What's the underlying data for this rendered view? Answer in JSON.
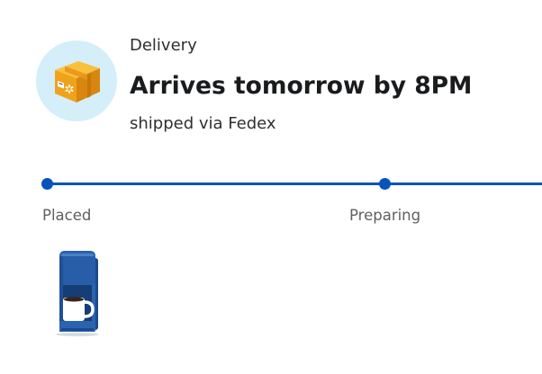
{
  "delivery": {
    "label": "Delivery",
    "title": "Arrives tomorrow by 8PM",
    "carrier_text": "shipped via Fedex",
    "icon": "package-box-icon"
  },
  "progress": {
    "steps": [
      {
        "label": "Placed",
        "status": "complete"
      },
      {
        "label": "Preparing",
        "status": "complete"
      }
    ]
  },
  "item": {
    "icon": "coffee-maker-product-image"
  },
  "colors": {
    "accent": "#0654ba",
    "icon_bg": "#d4eefa",
    "box": "#f5a623"
  }
}
